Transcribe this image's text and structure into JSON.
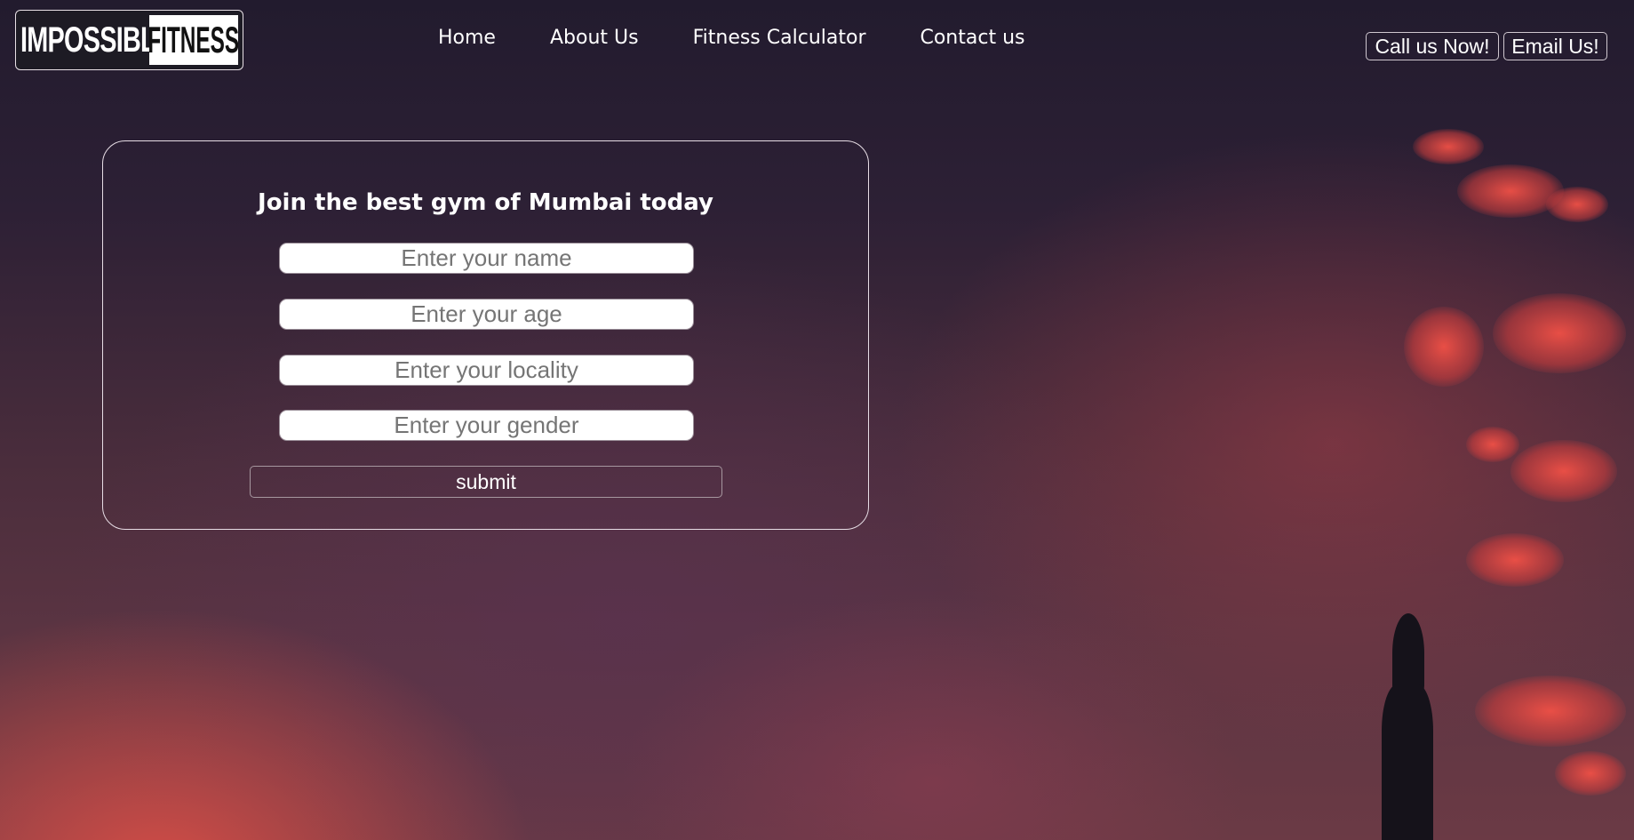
{
  "header": {
    "logo": {
      "left_text": "IMPOSSIBLE",
      "right_text": "FITNESS"
    },
    "nav": [
      {
        "label": "Home"
      },
      {
        "label": "About Us"
      },
      {
        "label": "Fitness Calculator"
      },
      {
        "label": "Contact us"
      }
    ],
    "call_button": "Call us Now!",
    "email_button": "Email Us!"
  },
  "form": {
    "title": "Join the best gym of Mumbai today",
    "fields": [
      {
        "placeholder": "Enter your name",
        "value": ""
      },
      {
        "placeholder": "Enter your age",
        "value": ""
      },
      {
        "placeholder": "Enter your locality",
        "value": ""
      },
      {
        "placeholder": "Enter your gender",
        "value": ""
      }
    ],
    "submit_label": "submit"
  },
  "colors": {
    "text": "#ffffff",
    "sky_dark": "#221b2e",
    "sky_warm": "#e55046"
  }
}
